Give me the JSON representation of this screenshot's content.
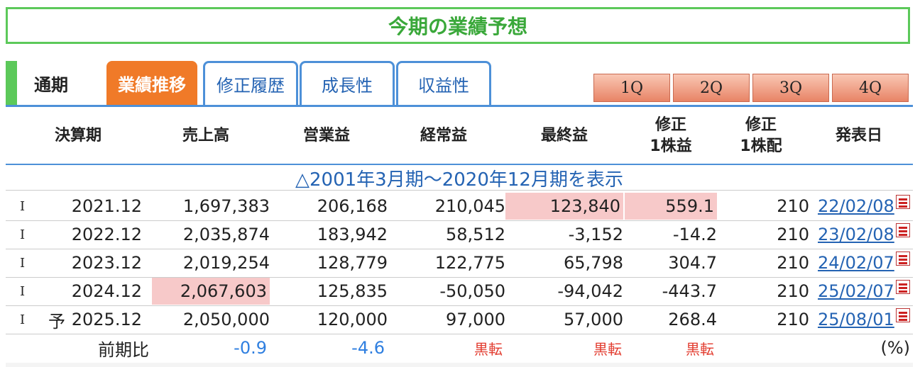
{
  "title": "今期の業績予想",
  "tabs": {
    "period_label": "通期",
    "active": "業績推移",
    "others": [
      "修正履歴",
      "成長性",
      "収益性"
    ],
    "quarters": [
      "1Q",
      "2Q",
      "3Q",
      "4Q"
    ]
  },
  "headers": {
    "period": "決算期",
    "sales": "売上高",
    "operating": "営業益",
    "ordinary": "経常益",
    "net": "最終益",
    "eps_line1": "修正",
    "eps_line2": "1株益",
    "div_line1": "修正",
    "div_line2": "1株配",
    "announce": "発表日"
  },
  "range_link": "△2001年3月期～2020年12月期を表示",
  "rows": [
    {
      "mark": "I",
      "forecast": "",
      "period": "2021.12",
      "sales": "1,697,383",
      "operating": "206,168",
      "ordinary": "210,045",
      "net": "123,840",
      "eps": "559.1",
      "div": "210",
      "date": "22/02/08"
    },
    {
      "mark": "I",
      "forecast": "",
      "period": "2022.12",
      "sales": "2,035,874",
      "operating": "183,942",
      "ordinary": "58,512",
      "net": "-3,152",
      "eps": "-14.2",
      "div": "210",
      "date": "23/02/08"
    },
    {
      "mark": "I",
      "forecast": "",
      "period": "2023.12",
      "sales": "2,019,254",
      "operating": "128,779",
      "ordinary": "122,775",
      "net": "65,798",
      "eps": "304.7",
      "div": "210",
      "date": "24/02/07"
    },
    {
      "mark": "I",
      "forecast": "",
      "period": "2024.12",
      "sales": "2,067,603",
      "operating": "125,835",
      "ordinary": "-50,050",
      "net": "-94,042",
      "eps": "-443.7",
      "div": "210",
      "date": "25/02/07"
    },
    {
      "mark": "I",
      "forecast": "予",
      "period": "2025.12",
      "sales": "2,050,000",
      "operating": "120,000",
      "ordinary": "97,000",
      "net": "57,000",
      "eps": "268.4",
      "div": "210",
      "date": "25/08/01"
    }
  ],
  "comparison": {
    "label": "前期比",
    "sales": "-0.9",
    "operating": "-4.6",
    "ordinary": "黒転",
    "net": "黒転",
    "eps": "黒転",
    "unit": "(%)"
  },
  "colors": {
    "accent_green": "#5cc95a",
    "active_tab": "#f07a28",
    "tab_border": "#4d90d8",
    "highlight": "#f7c9c9",
    "positive_change": "#2f7fe0",
    "turnaround": "#e23b2e"
  },
  "icons": {
    "pdf": "pdf-icon"
  }
}
